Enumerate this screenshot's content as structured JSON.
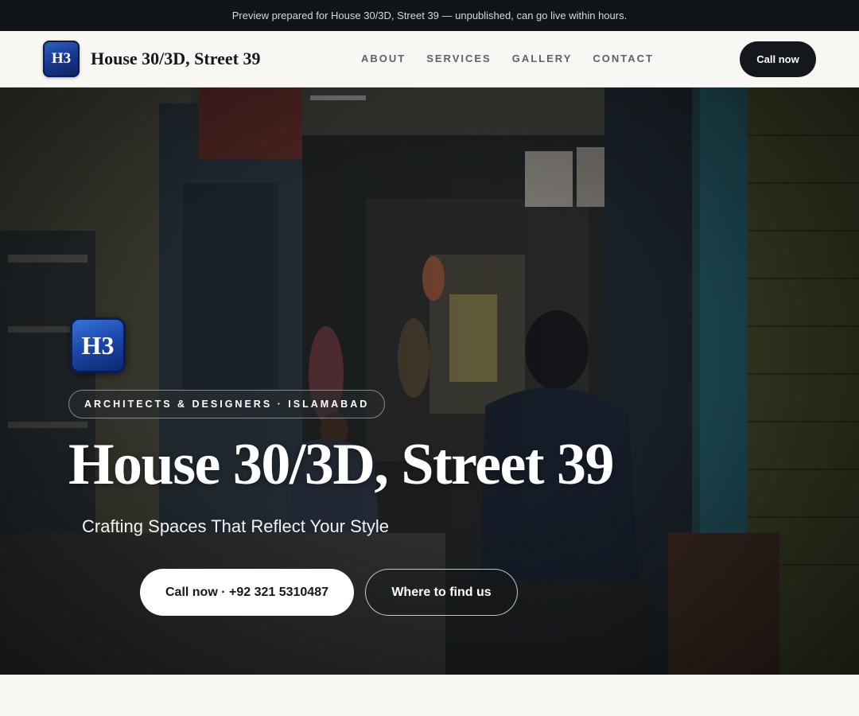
{
  "banner": {
    "text": "Preview prepared for House 30/3D, Street 39 — unpublished, can go live within hours."
  },
  "header": {
    "logo_text": "H3",
    "brand_name": "House 30/3D, Street 39",
    "nav": [
      {
        "label": "ABOUT"
      },
      {
        "label": "SERVICES"
      },
      {
        "label": "GALLERY"
      },
      {
        "label": "CONTACT"
      }
    ],
    "cta_label": "Call now"
  },
  "hero": {
    "logo_text": "H3",
    "badge": "ARCHITECTS & DESIGNERS · ISLAMABAD",
    "title": "House 30/3D, Street 39",
    "subtitle": "Crafting Spaces That Reflect Your Style",
    "primary_button": "Call now · +92 321 5310487",
    "secondary_button": "Where to find us"
  },
  "colors": {
    "banner_bg": "#111418",
    "page_bg": "#f8f7f3",
    "ink": "#14171c",
    "logo_blue": "#1a46a8"
  }
}
